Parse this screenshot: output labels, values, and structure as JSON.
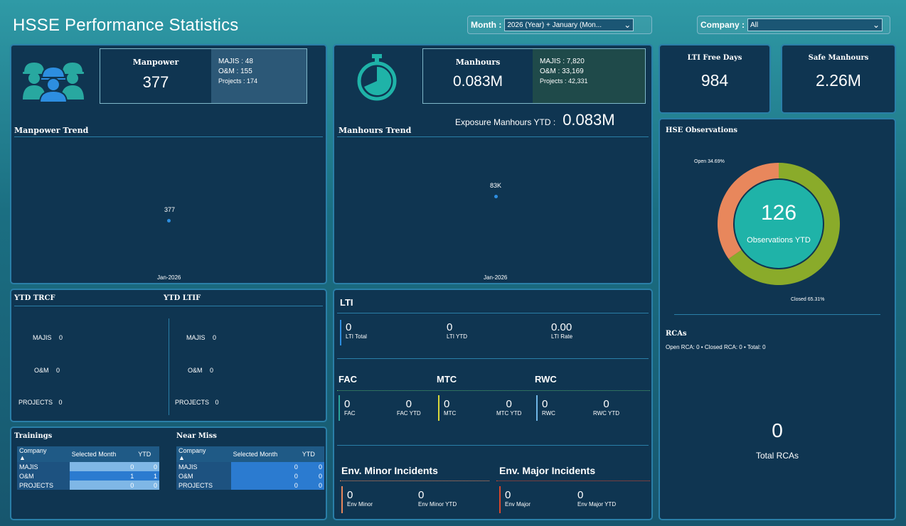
{
  "header": {
    "title": "HSSE Performance Statistics",
    "month_label": "Month :",
    "month_value": "2026 (Year) + January (Mon...",
    "company_label": "Company :",
    "company_value": "All"
  },
  "manpower": {
    "title": "Manpower",
    "value": "377",
    "majis": "MAJIS : 48",
    "om": "O&M : 155",
    "projects": "Projects : 174",
    "icon": "workers-icon",
    "trend_title": "Manpower Trend",
    "trend_point_label": "377",
    "trend_x_label": "Jan-2026"
  },
  "manhours": {
    "title": "Manhours",
    "value": "0.083M",
    "majis": "MAJIS : 7,820",
    "om": "O&M : 33,169",
    "projects": "Projects : 42,331",
    "icon": "stopwatch-icon",
    "exposure_label": "Exposure Manhours YTD :",
    "exposure_value": "0.083M",
    "trend_title": "Manhours Trend",
    "trend_point_label": "83K",
    "trend_x_label": "Jan-2026"
  },
  "lti_free": {
    "title": "LTI Free Days",
    "value": "984"
  },
  "safe_manhours": {
    "title": "Safe Manhours",
    "value": "2.26M"
  },
  "observations": {
    "title": "HSE Observations",
    "center_value": "126",
    "center_label": "Observations YTD",
    "open_label": "Open 34.69%",
    "closed_label": "Closed 65.31%",
    "open_pct": 34.69,
    "closed_pct": 65.31,
    "open_color": "#e8875c",
    "closed_color": "#8aab2a",
    "center_color": "#1fb3a8"
  },
  "rcas": {
    "title": "RCAs",
    "summary": "Open RCA: 0 • Closed RCA: 0 • Total: 0",
    "total_value": "0",
    "total_label": "Total RCAs"
  },
  "trcf": {
    "title": "YTD TRCF",
    "rows": [
      {
        "label": "MAJIS",
        "value": "0"
      },
      {
        "label": "O&M",
        "value": "0"
      },
      {
        "label": "PROJECTS",
        "value": "0"
      }
    ]
  },
  "ltif": {
    "title": "YTD LTIF",
    "rows": [
      {
        "label": "MAJIS",
        "value": "0"
      },
      {
        "label": "O&M",
        "value": "0"
      },
      {
        "label": "PROJECTS",
        "value": "0"
      }
    ]
  },
  "trainings": {
    "title": "Trainings",
    "headers": [
      "Company",
      "Selected Month",
      "YTD"
    ],
    "rows": [
      {
        "company": "MAJIS",
        "month": "0",
        "ytd": "0"
      },
      {
        "company": "O&M",
        "month": "1",
        "ytd": "1"
      },
      {
        "company": "PROJECTS",
        "month": "0",
        "ytd": "0"
      }
    ]
  },
  "near_miss": {
    "title": "Near Miss",
    "headers": [
      "Company",
      "Selected Month",
      "YTD"
    ],
    "rows": [
      {
        "company": "MAJIS",
        "month": "0",
        "ytd": "0"
      },
      {
        "company": "O&M",
        "month": "0",
        "ytd": "0"
      },
      {
        "company": "PROJECTS",
        "month": "0",
        "ytd": "0"
      }
    ]
  },
  "lti": {
    "title": "LTI",
    "items": [
      {
        "value": "0",
        "label": "LTI Total"
      },
      {
        "value": "0",
        "label": "LTI YTD"
      },
      {
        "value": "0.00",
        "label": "LTI Rate"
      }
    ]
  },
  "fac": {
    "title": "FAC",
    "value": "0",
    "label": "FAC",
    "ytd_value": "0",
    "ytd_label": "FAC YTD"
  },
  "mtc": {
    "title": "MTC",
    "value": "0",
    "label": "MTC",
    "ytd_value": "0",
    "ytd_label": "MTC YTD"
  },
  "rwc": {
    "title": "RWC",
    "value": "0",
    "label": "RWC",
    "ytd_value": "0",
    "ytd_label": "RWC YTD"
  },
  "env_minor": {
    "title": "Env. Minor Incidents",
    "value": "0",
    "label": "Env Minor",
    "ytd_value": "0",
    "ytd_label": "Env Minor YTD"
  },
  "env_major": {
    "title": "Env. Major Incidents",
    "value": "0",
    "label": "Env Major",
    "ytd_value": "0",
    "ytd_label": "Env Major YTD"
  },
  "colors": {
    "panel_bg": "#0f3551",
    "accent_blue": "#2d8ee0",
    "fac_bar": "#2aa39a",
    "mtc_bar": "#d8d63a",
    "rwc_bar": "#6fb6e6",
    "env_minor_bar": "#e8875c",
    "env_major_bar": "#d9472c"
  }
}
